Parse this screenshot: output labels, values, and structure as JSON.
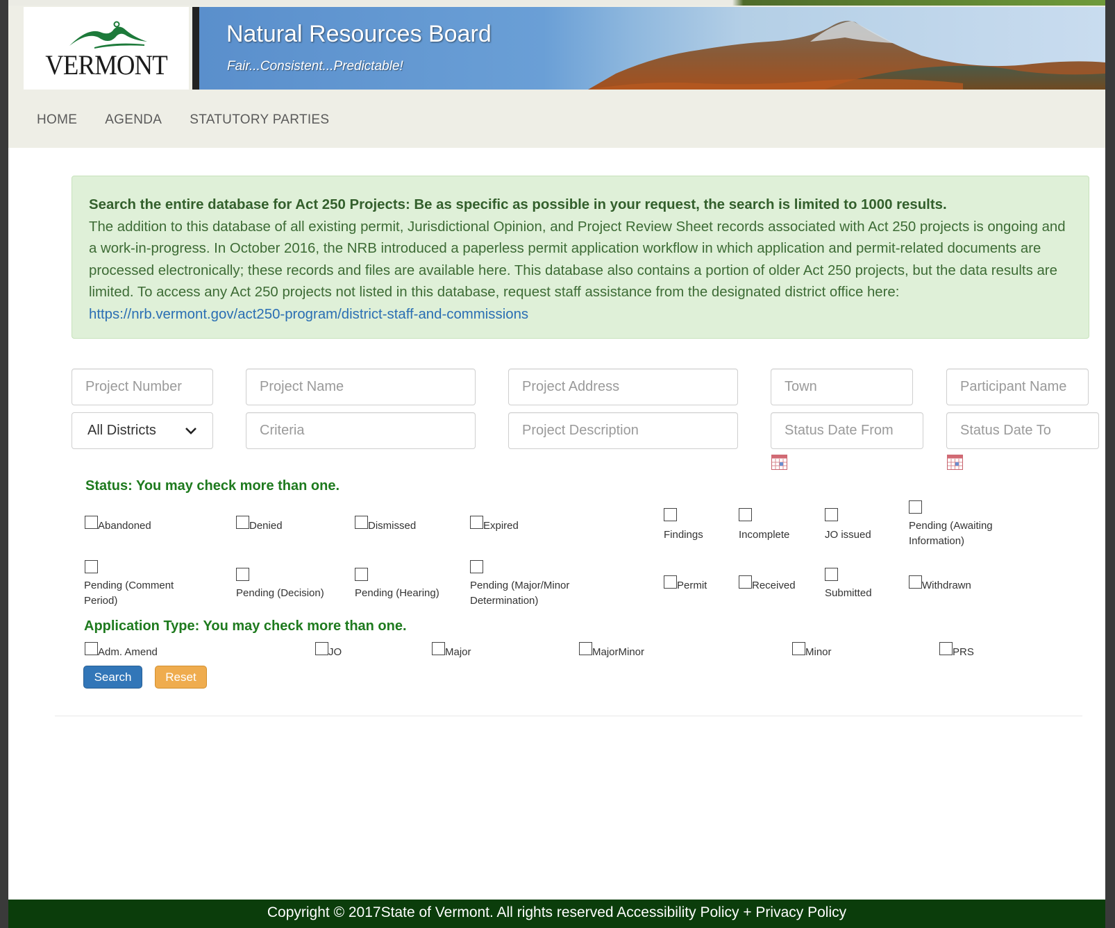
{
  "header": {
    "logo_text": "VERMONT",
    "title": "Natural Resources Board",
    "tagline": "Fair...Consistent...Predictable!"
  },
  "nav": [
    {
      "label": "HOME"
    },
    {
      "label": "AGENDA"
    },
    {
      "label": "STATUTORY PARTIES"
    }
  ],
  "info": {
    "heading": "Search the entire database for Act 250 Projects: Be as specific as possible in your request, the search is limited to 1000 results.",
    "body": "The addition to this database of all existing permit, Jurisdictional Opinion, and Project Review Sheet records associated with Act 250 projects is ongoing and a work-in-progress. In October 2016, the NRB introduced a paperless permit application workflow in which application and permit-related documents are processed electronically; these records and files are available here. This database also contains a portion of older Act 250 projects, but the data results are limited. To access any Act 250 projects not listed in this database, request staff assistance from the designated district office here: ",
    "link": "https://nrb.vermont.gov/act250-program/district-staff-and-commissions"
  },
  "form": {
    "project_number": {
      "placeholder": "Project Number",
      "value": ""
    },
    "project_name": {
      "placeholder": "Project Name",
      "value": ""
    },
    "project_address": {
      "placeholder": "Project Address",
      "value": ""
    },
    "town": {
      "placeholder": "Town",
      "value": ""
    },
    "participant_name": {
      "placeholder": "Participant Name",
      "value": ""
    },
    "district": {
      "selected": "All Districts"
    },
    "criteria": {
      "placeholder": "Criteria",
      "value": ""
    },
    "project_description": {
      "placeholder": "Project Description",
      "value": ""
    },
    "status_date_from": {
      "placeholder": "Status Date From",
      "value": ""
    },
    "status_date_to": {
      "placeholder": "Status Date To",
      "value": ""
    }
  },
  "status": {
    "title": "Status: You may check more than one.",
    "options": [
      {
        "label": "Abandoned",
        "checked": false
      },
      {
        "label": "Denied",
        "checked": false
      },
      {
        "label": "Dismissed",
        "checked": false
      },
      {
        "label": "Expired",
        "checked": false
      },
      {
        "label": "Findings",
        "checked": false
      },
      {
        "label": "Incomplete",
        "checked": false
      },
      {
        "label": "JO issued",
        "checked": false
      },
      {
        "label": "Pending (Awaiting Information)",
        "line1": "Pending (Awaiting",
        "line2": "Information)",
        "checked": false
      },
      {
        "label": "Pending (Comment Period)",
        "line1": "Pending (Comment",
        "line2": "Period)",
        "checked": false
      },
      {
        "label": "Pending (Decision)",
        "checked": false
      },
      {
        "label": "Pending (Hearing)",
        "checked": false
      },
      {
        "label": "Pending (Major/Minor Determination)",
        "line1": "Pending (Major/Minor",
        "line2": "Determination)",
        "checked": false
      },
      {
        "label": "Permit",
        "checked": false
      },
      {
        "label": "Received",
        "checked": false
      },
      {
        "label": "Submitted",
        "checked": false
      },
      {
        "label": "Withdrawn",
        "checked": false
      }
    ]
  },
  "app_type": {
    "title": "Application Type: You may check more than one.",
    "options": [
      {
        "label": "Adm. Amend",
        "checked": false
      },
      {
        "label": "JO",
        "checked": false
      },
      {
        "label": "Major",
        "checked": false
      },
      {
        "label": "MajorMinor",
        "checked": false
      },
      {
        "label": "Minor",
        "checked": false
      },
      {
        "label": "PRS",
        "checked": false
      }
    ]
  },
  "buttons": {
    "search": "Search",
    "reset": "Reset"
  },
  "footer": {
    "copyright": "Copyright © 2017State of Vermont. All rights reserved ",
    "accessibility": "Accessibility Policy",
    "sep": " + ",
    "privacy": "Privacy Policy"
  },
  "colors": {
    "status_title": "#1e7a1e",
    "info_bg": "#dff0d8",
    "search_button": "#3276b8",
    "reset_button": "#efac4e",
    "footer_bg": "#0b3d0b"
  },
  "icons": {
    "calendar": "calendar-icon",
    "dropdown": "chevron-down-icon"
  }
}
